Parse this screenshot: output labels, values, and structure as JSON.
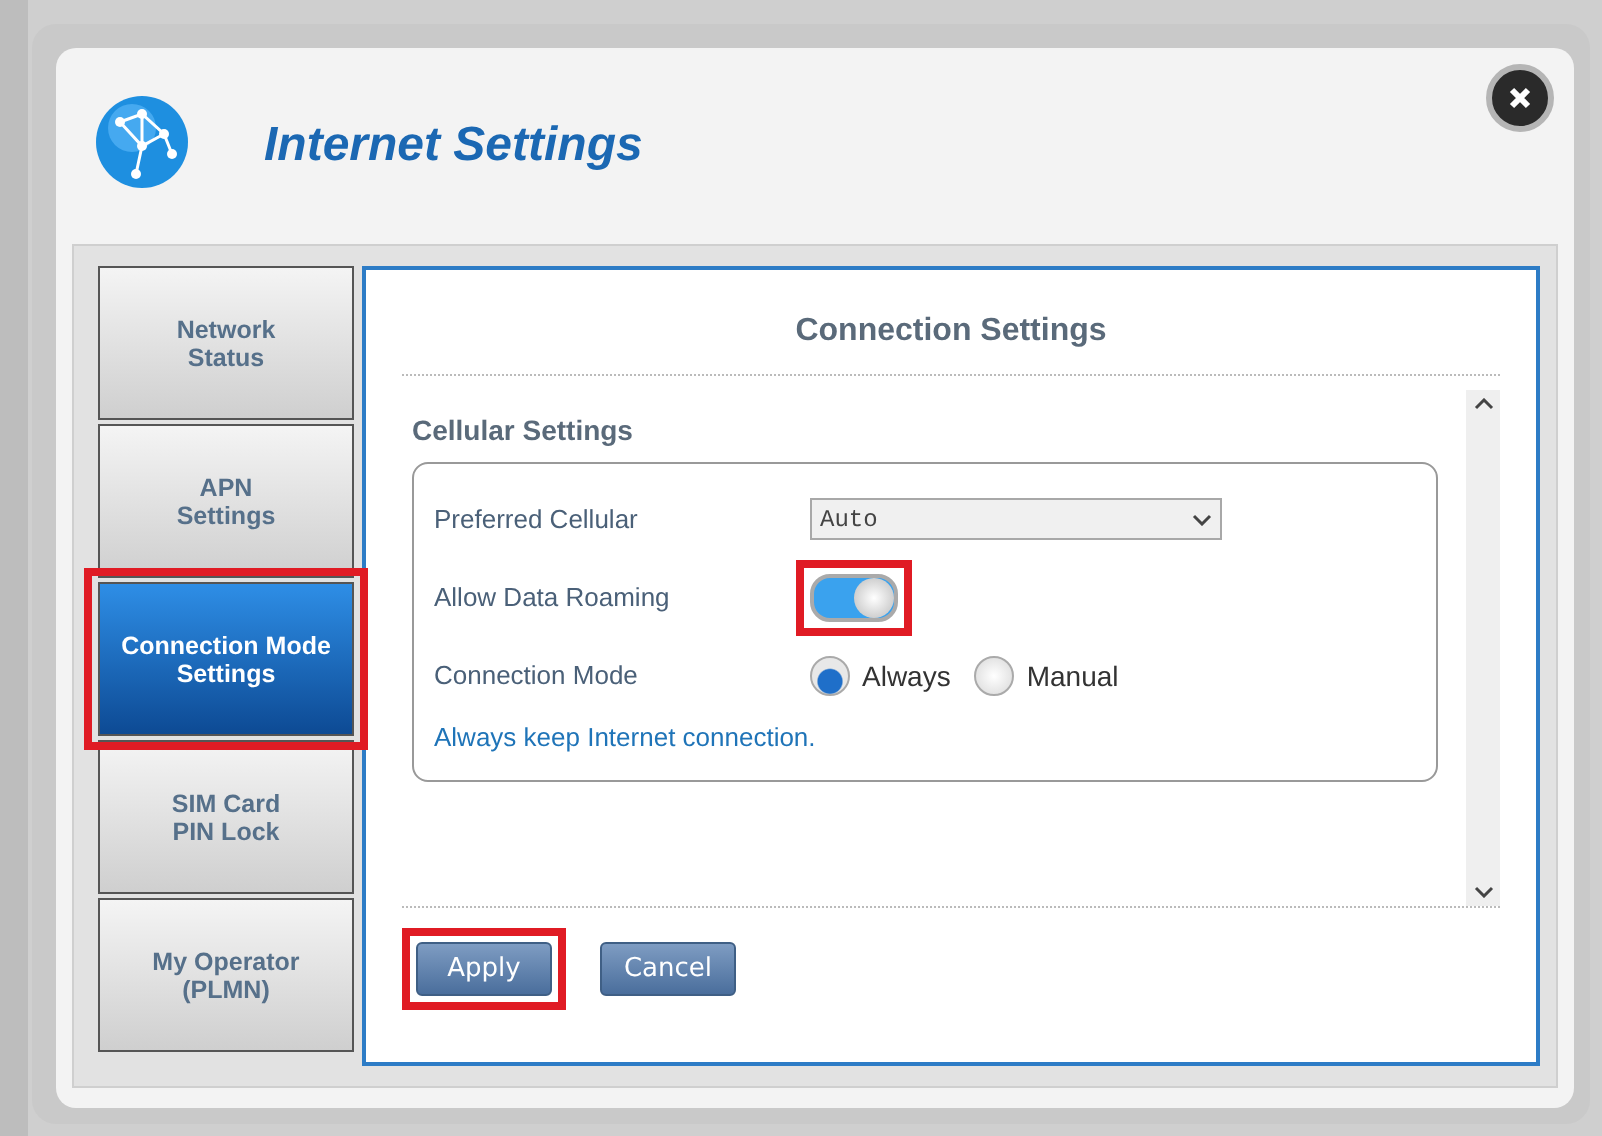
{
  "dialog": {
    "title": "Internet Settings"
  },
  "sidebar": {
    "items": [
      {
        "label_lines": [
          "Network",
          "Status"
        ],
        "selected": false,
        "highlighted": false
      },
      {
        "label_lines": [
          "APN",
          "Settings"
        ],
        "selected": false,
        "highlighted": false
      },
      {
        "label_lines": [
          "Connection Mode",
          "Settings"
        ],
        "selected": true,
        "highlighted": true
      },
      {
        "label_lines": [
          "SIM Card",
          "PIN Lock"
        ],
        "selected": false,
        "highlighted": false
      },
      {
        "label_lines": [
          "My Operator",
          "(PLMN)"
        ],
        "selected": false,
        "highlighted": false
      }
    ]
  },
  "panel": {
    "title": "Connection Settings",
    "section_title": "Cellular Settings",
    "fields": [
      {
        "kind": "select",
        "label": "Preferred Cellular",
        "value": "Auto"
      },
      {
        "kind": "toggle",
        "label": "Allow Data Roaming",
        "on": true,
        "highlighted": true
      },
      {
        "kind": "radio",
        "label": "Connection Mode",
        "options": [
          {
            "label": "Always",
            "selected": true
          },
          {
            "label": "Manual",
            "selected": false
          }
        ]
      }
    ],
    "note": "Always keep Internet connection.",
    "buttons": [
      {
        "label": "Apply",
        "highlighted": true
      },
      {
        "label": "Cancel",
        "highlighted": false
      }
    ]
  }
}
